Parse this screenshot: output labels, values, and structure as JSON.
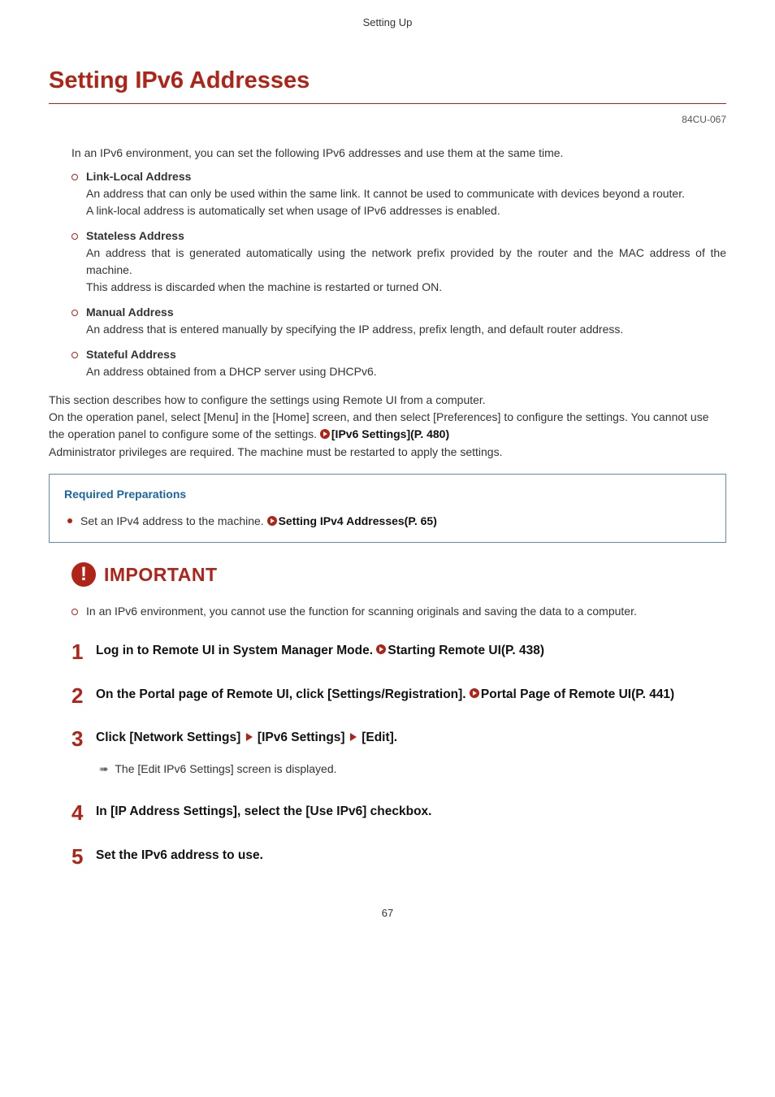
{
  "header": {
    "section": "Setting Up"
  },
  "title": "Setting IPv6 Addresses",
  "doc_id": "84CU-067",
  "intro": "In an IPv6 environment, you can set the following IPv6 addresses and use them at the same time.",
  "address_types": [
    {
      "name": "Link-Local Address",
      "lines": [
        "An address that can only be used within the same link. It cannot be used to communicate with devices beyond a router.",
        "A link-local address is automatically set when usage of IPv6 addresses is enabled."
      ]
    },
    {
      "name": "Stateless Address",
      "lines": [
        "An address that is generated automatically using the network prefix provided by the router and the MAC address of the machine.",
        "This address is discarded when the machine is restarted or turned ON."
      ]
    },
    {
      "name": "Manual Address",
      "lines": [
        "An address that is entered manually by specifying the IP address, prefix length, and default router address."
      ]
    },
    {
      "name": "Stateful Address",
      "lines": [
        "An address obtained from a DHCP server using DHCPv6."
      ]
    }
  ],
  "section_body": {
    "l1": "This section describes how to configure the settings using Remote UI from a computer.",
    "l2": "On the operation panel, select [Menu] in the [Home] screen, and then select [Preferences] to configure the settings. You cannot use the operation panel to configure some of the settings. ",
    "l2_link": "[IPv6 Settings](P. 480)",
    "l3": "Administrator privileges are required. The machine must be restarted to apply the settings."
  },
  "prep": {
    "title": "Required Preparations",
    "item_text": "Set an IPv4 address to the machine. ",
    "item_link": "Setting IPv4 Addresses(P. 65)"
  },
  "important": {
    "label": "IMPORTANT",
    "text": "In an IPv6 environment, you cannot use the function for scanning originals and saving the data to a computer."
  },
  "steps": [
    {
      "pre": "Log in to Remote UI in System Manager Mode. ",
      "link": "Starting Remote UI(P. 438)"
    },
    {
      "pre": "On the Portal page of Remote UI, click [Settings/Registration]. ",
      "link": "Portal Page of Remote UI(P. 441)"
    },
    {
      "seg1": "Click [Network Settings] ",
      "seg2": " [IPv6 Settings] ",
      "seg3": " [Edit].",
      "result": "The [Edit IPv6 Settings] screen is displayed."
    },
    {
      "plain": "In [IP Address Settings], select the [Use IPv6] checkbox."
    },
    {
      "plain": "Set the IPv6 address to use."
    }
  ],
  "page_number": "67"
}
